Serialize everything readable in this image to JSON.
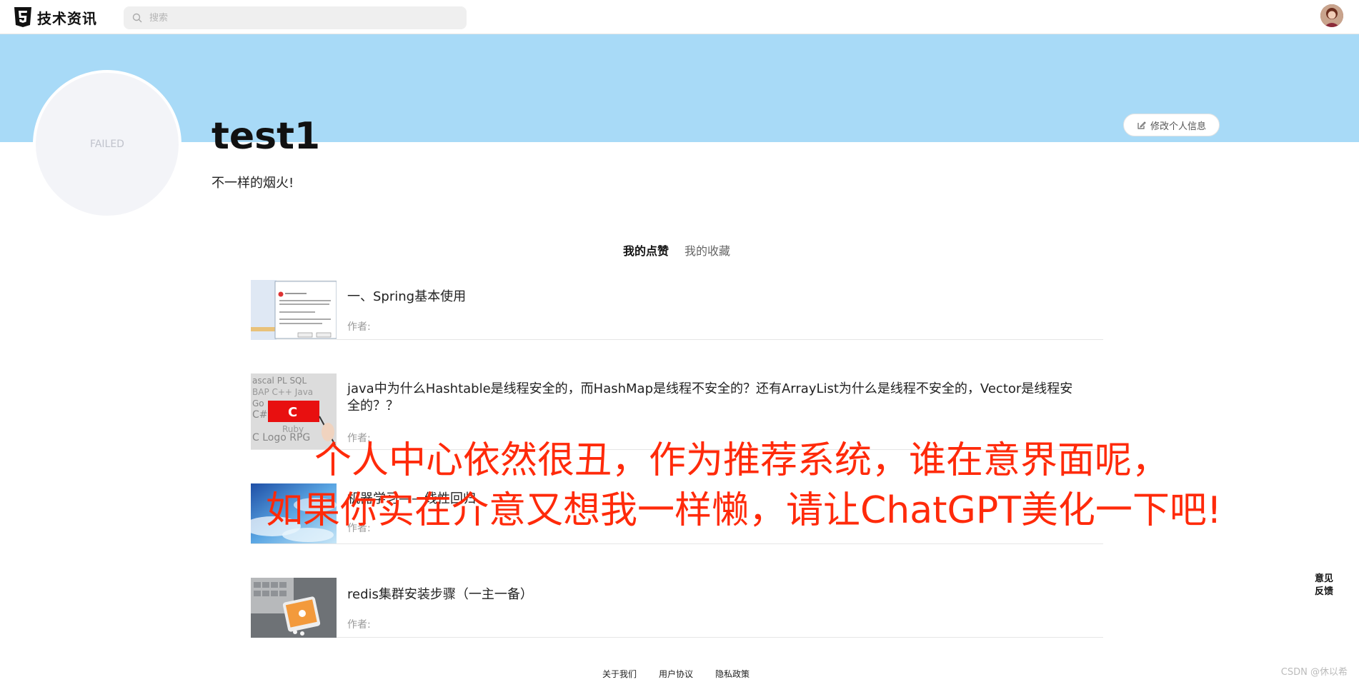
{
  "header": {
    "logo_text": "技术资讯",
    "search_placeholder": "搜索"
  },
  "profile": {
    "avatar_text": "FAILED",
    "username": "test1",
    "bio": "不一样的烟火!",
    "edit_label": "修改个人信息"
  },
  "tabs": [
    {
      "label": "我的点赞",
      "active": true
    },
    {
      "label": "我的收藏",
      "active": false
    }
  ],
  "articles": [
    {
      "title": "一、Spring基本使用",
      "author_label": "作者:"
    },
    {
      "title": "java中为什么Hashtable是线程安全的，而HashMap是线程不安全的？还有ArrayList为什么是线程不安全的，Vector是线程安全的？？",
      "author_label": "作者:"
    },
    {
      "title": "机器学习——线性回归",
      "author_label": "作者:"
    },
    {
      "title": "redis集群安装步骤（一主一备）",
      "author_label": "作者:"
    }
  ],
  "overlay": {
    "line1": "个人中心依然很丑，作为推荐系统，谁在意界面呢，",
    "line2": "如果你实在介意又想我一样懒，请让ChatGPT美化一下吧!"
  },
  "feedback_label": "意见反馈",
  "footer": {
    "links": [
      "关于我们",
      "用户协议",
      "隐私政策"
    ],
    "watermark": "CSDN @休以希"
  },
  "colors": {
    "banner": "#a8daf7",
    "overlay_text": "#ff2a0a"
  }
}
